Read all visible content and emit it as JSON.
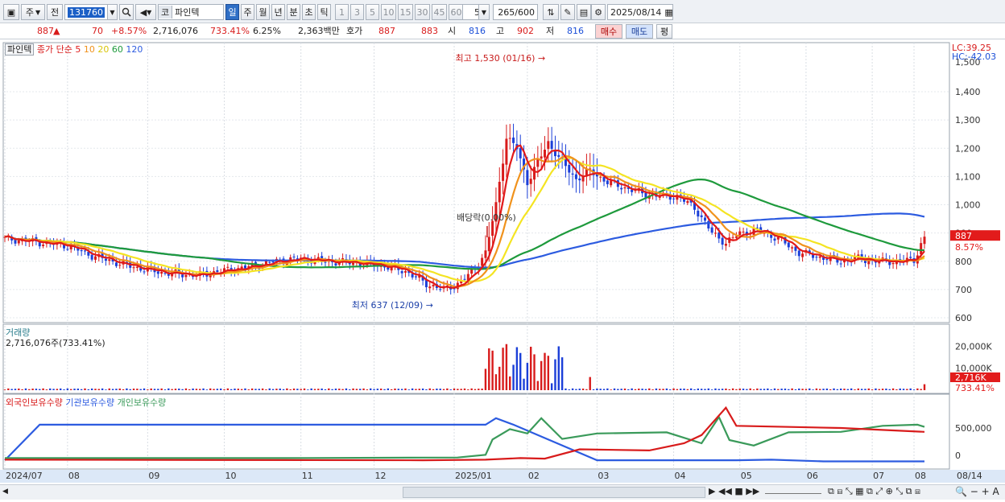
{
  "toolbar": {
    "market_label": "주",
    "prev_label": "전",
    "code": "131760",
    "market_type": "코",
    "stock_name": "파인텍",
    "periods": [
      "일",
      "주",
      "월",
      "년",
      "분",
      "초",
      "틱"
    ],
    "active_period": "일",
    "intervals": [
      "1",
      "3",
      "5",
      "10",
      "15",
      "30",
      "45",
      "60"
    ],
    "interval_value": "5",
    "bar_count": "265",
    "bar_total": "/600",
    "date": "2025/08/14"
  },
  "quote": {
    "price": "887",
    "arrow": "▲",
    "change": "70",
    "change_pct": "+8.57%",
    "volume": "2,716,076",
    "volume_ratio": "733.41%",
    "turnover": "6.25%",
    "amount": "2,363백만",
    "hoga_label": "호가",
    "ask": "887",
    "bid": "883",
    "open_label": "시",
    "open": "816",
    "high_label": "고",
    "high": "902",
    "low_label": "저",
    "low": "816",
    "buy_label": "매수",
    "sell_label": "매도",
    "eval_label": "평"
  },
  "price_panel": {
    "stock_tag": "파인텍",
    "ma_title": "종가 단순",
    "ma_periods": [
      "5",
      "10",
      "20",
      "60",
      "120"
    ],
    "lc": "LC:39.25",
    "hc": "HC:-42.03",
    "y_ticks": [
      "1,400",
      "1,300",
      "1,200",
      "1,100",
      "1,000",
      "900",
      "800",
      "700",
      "600"
    ],
    "partial_tick": "1,500",
    "high_note": "최고 1,530 (01/16)",
    "low_note": "최저 637 (12/09)",
    "dividend_note": "배당락(0.00%)",
    "last_price_tag": "887",
    "last_pct_tag": "8.57%"
  },
  "volume_panel": {
    "title": "거래량",
    "value": "2,716,076주(733.41%)",
    "y_ticks": [
      "20,000K",
      "10,000K"
    ],
    "last_tag": "2,716K",
    "last_pct": "733.41%"
  },
  "holdings_panel": {
    "legend": [
      "외국인보유수량",
      "기관보유수량",
      "개인보유수량"
    ],
    "y_ticks": [
      "500,000",
      "0"
    ]
  },
  "x_axis": {
    "labels": [
      "2024/07",
      "08",
      "09",
      "10",
      "11",
      "12",
      "2025/01",
      "02",
      "03",
      "04",
      "05",
      "06",
      "07",
      "08"
    ],
    "right_label": "08/14"
  },
  "colors": {
    "up": "#d81b1b",
    "down": "#1b3fd8",
    "ma5": "#e11a1a",
    "ma10": "#f0921c",
    "ma20": "#f4e422",
    "ma60": "#1e9a3c",
    "ma120": "#2c5be0",
    "foreign": "#d81b1b",
    "institution": "#2c5be0",
    "individual": "#3a9a5a"
  },
  "icons": [
    "window-icon",
    "search-icon",
    "speaker-icon",
    "settings-icon",
    "save-icon",
    "calendar-icon"
  ]
}
